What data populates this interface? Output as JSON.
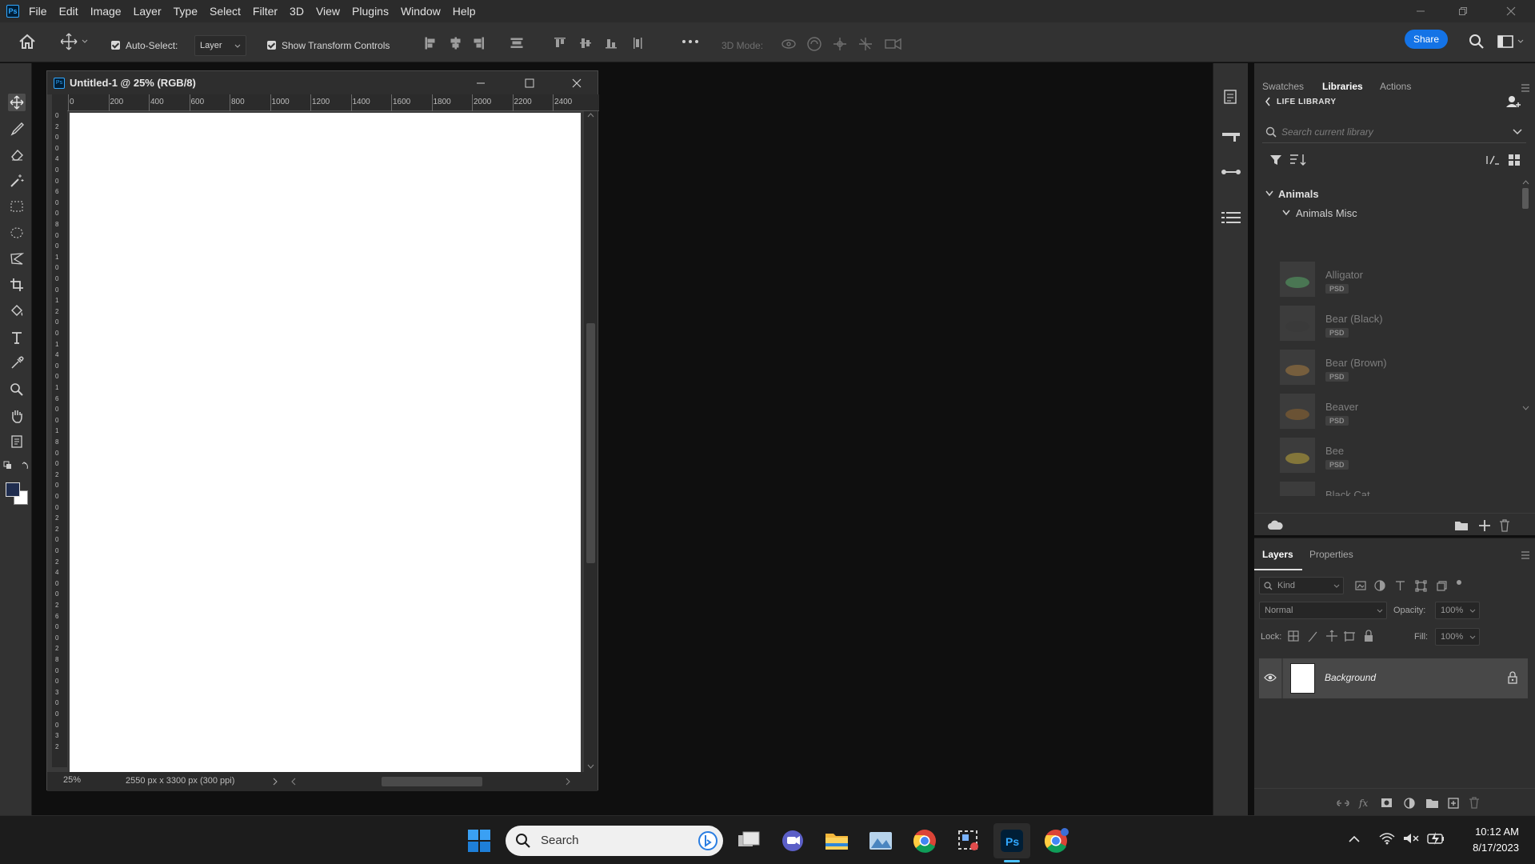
{
  "app": {
    "logo": "Ps",
    "menu": [
      "File",
      "Edit",
      "Image",
      "Layer",
      "Type",
      "Select",
      "Filter",
      "3D",
      "View",
      "Plugins",
      "Window",
      "Help"
    ]
  },
  "options_bar": {
    "auto_select_label": "Auto-Select:",
    "auto_select_target": "Layer",
    "show_transform_label": "Show Transform Controls",
    "mode_3d_label": "3D Mode:",
    "share_label": "Share"
  },
  "document": {
    "title": "Untitled-1 @ 25% (RGB/8)",
    "ruler_h": [
      "0",
      "200",
      "400",
      "600",
      "800",
      "1000",
      "1200",
      "1400",
      "1600",
      "1800",
      "2000",
      "2200",
      "2400"
    ],
    "ruler_v": [
      "0",
      "2",
      "0",
      "0",
      "4",
      "0",
      "0",
      "6",
      "0",
      "0",
      "8",
      "0",
      "0",
      "1",
      "0",
      "0",
      "0",
      "1",
      "2",
      "0",
      "0",
      "1",
      "4",
      "0",
      "0",
      "1",
      "6",
      "0",
      "0",
      "1",
      "8",
      "0",
      "0",
      "2",
      "0",
      "0",
      "0",
      "2",
      "2",
      "0",
      "0",
      "2",
      "4",
      "0",
      "0",
      "2",
      "6",
      "0",
      "0",
      "2",
      "8",
      "0",
      "0",
      "3",
      "0",
      "0",
      "0",
      "3",
      "2"
    ],
    "zoom": "25%",
    "status": "2550 px x 3300 px (300 ppi)"
  },
  "libraries": {
    "tabs": [
      "Swatches",
      "Libraries",
      "Actions"
    ],
    "active_tab": "Libraries",
    "library_name": "LIFE LIBRARY",
    "search_placeholder": "Search current library",
    "group": "Animals",
    "subgroup": "Animals Misc",
    "items": [
      {
        "name": "Alligator",
        "type": "PSD",
        "color": "#4f8a5b"
      },
      {
        "name": "Bear (Black)",
        "type": "PSD",
        "color": "#3a3a3a"
      },
      {
        "name": "Bear (Brown)",
        "type": "PSD",
        "color": "#8a6a3e"
      },
      {
        "name": "Beaver",
        "type": "PSD",
        "color": "#7a5a32"
      },
      {
        "name": "Bee",
        "type": "PSD",
        "color": "#9b8a3a"
      },
      {
        "name": "Black Cat",
        "type": "",
        "color": "#333333"
      }
    ]
  },
  "layers": {
    "tabs": [
      "Layers",
      "Properties"
    ],
    "active_tab": "Layers",
    "kind_label": "Kind",
    "blend_mode": "Normal",
    "opacity_label": "Opacity:",
    "opacity_value": "100%",
    "lock_label": "Lock:",
    "fill_label": "Fill:",
    "fill_value": "100%",
    "items": [
      {
        "name": "Background"
      }
    ]
  },
  "taskbar": {
    "search_label": "Search",
    "time": "10:12 AM",
    "date": "8/17/2023"
  },
  "colors": {
    "foreground": "#1f2d4f",
    "background": "#ffffff",
    "accent": "#1473e6"
  }
}
